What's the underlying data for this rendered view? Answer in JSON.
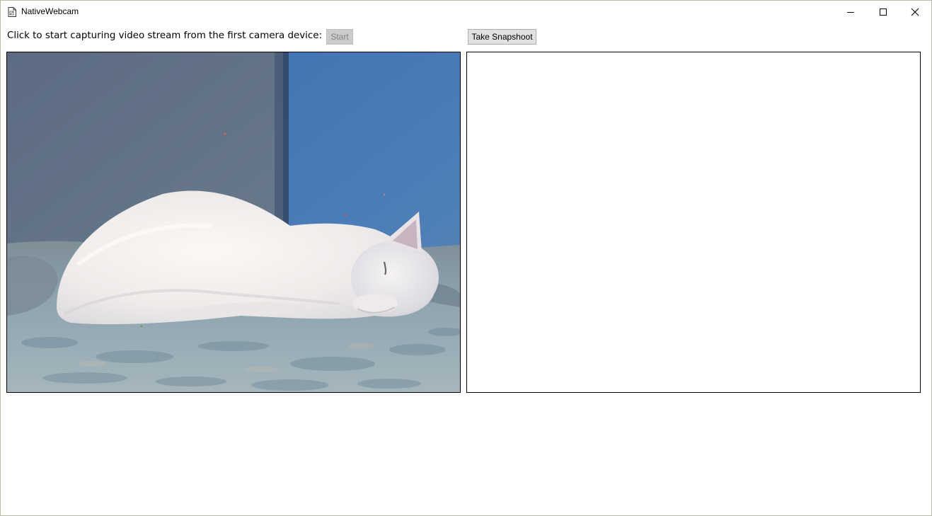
{
  "window": {
    "title": "NativeWebcam",
    "icon": "document-icon",
    "controls": [
      "minimize-icon",
      "maximize-icon",
      "close-icon"
    ]
  },
  "toolbar": {
    "prompt": "Click to start capturing video stream from the first camera device:",
    "start_label": "Start",
    "start_enabled": false,
    "snapshot_label": "Take Snapshoot"
  },
  "video": {
    "state": "streaming"
  },
  "snapshot": {
    "state": "empty"
  },
  "colors": {
    "window_border": "#b9b9a8",
    "button_face": "#e1e1e1",
    "button_disabled": "#cccccc",
    "wall_blue": "#4a74ad",
    "wall_gray": "#5f6e83",
    "cat_white": "#f2eeec",
    "blanket": "#8fa5b3"
  }
}
